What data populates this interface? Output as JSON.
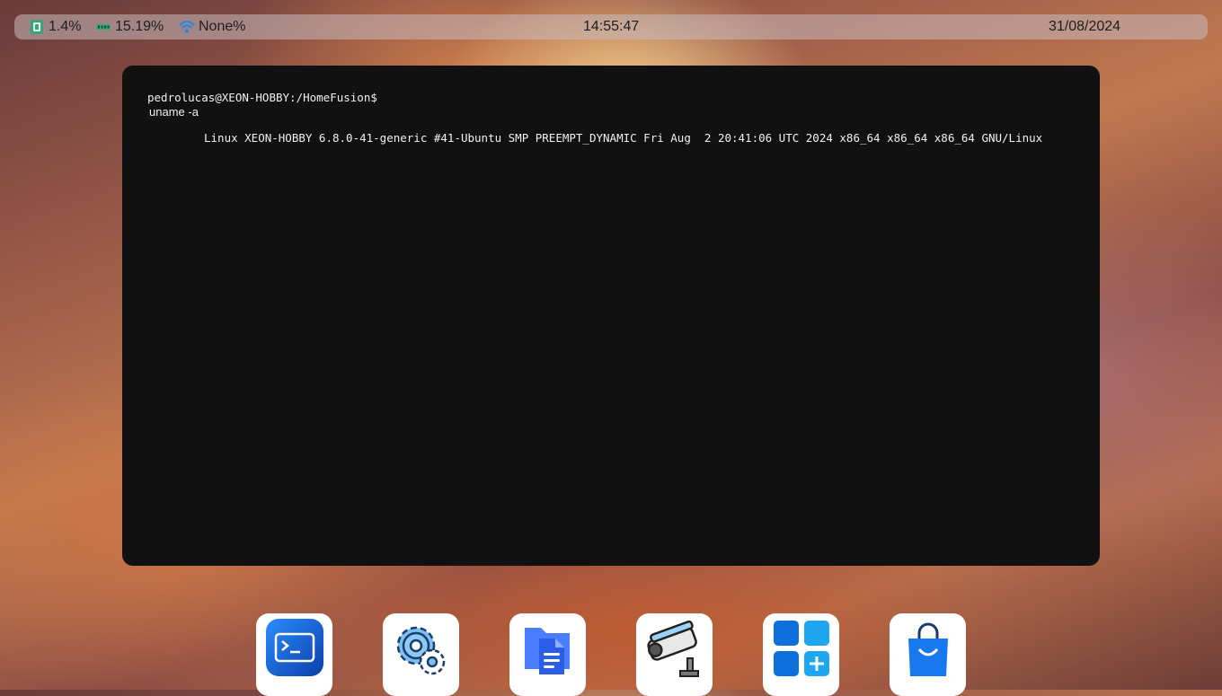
{
  "topbar": {
    "cpu": "1.4%",
    "ram": "15.19%",
    "wifi": "None%",
    "time": "14:55:47",
    "date": "31/08/2024",
    "icons": {
      "cpu": "cpu-chip-icon",
      "ram": "memory-icon",
      "wifi": "wifi-icon"
    }
  },
  "terminal": {
    "prompt": "pedrolucas@XEON-HOBBY:/HomeFusion$",
    "command": "uname -a",
    "output": "Linux XEON-HOBBY 6.8.0-41-generic #41-Ubuntu SMP PREEMPT_DYNAMIC Fri Aug  2 20:41:06 UTC 2024 x86_64 x86_64 x86_64 GNU/Linux"
  },
  "dock": {
    "apps": [
      {
        "icon": "terminal-icon"
      },
      {
        "icon": "settings-gear-icon"
      },
      {
        "icon": "file-manager-icon"
      },
      {
        "icon": "security-camera-icon"
      },
      {
        "icon": "app-grid-icon"
      },
      {
        "icon": "store-bag-icon"
      }
    ]
  },
  "colors": {
    "terminal_bg": "#111111",
    "accent_blue": "#1a73e8",
    "topbar_bg": "#c8b9be"
  }
}
